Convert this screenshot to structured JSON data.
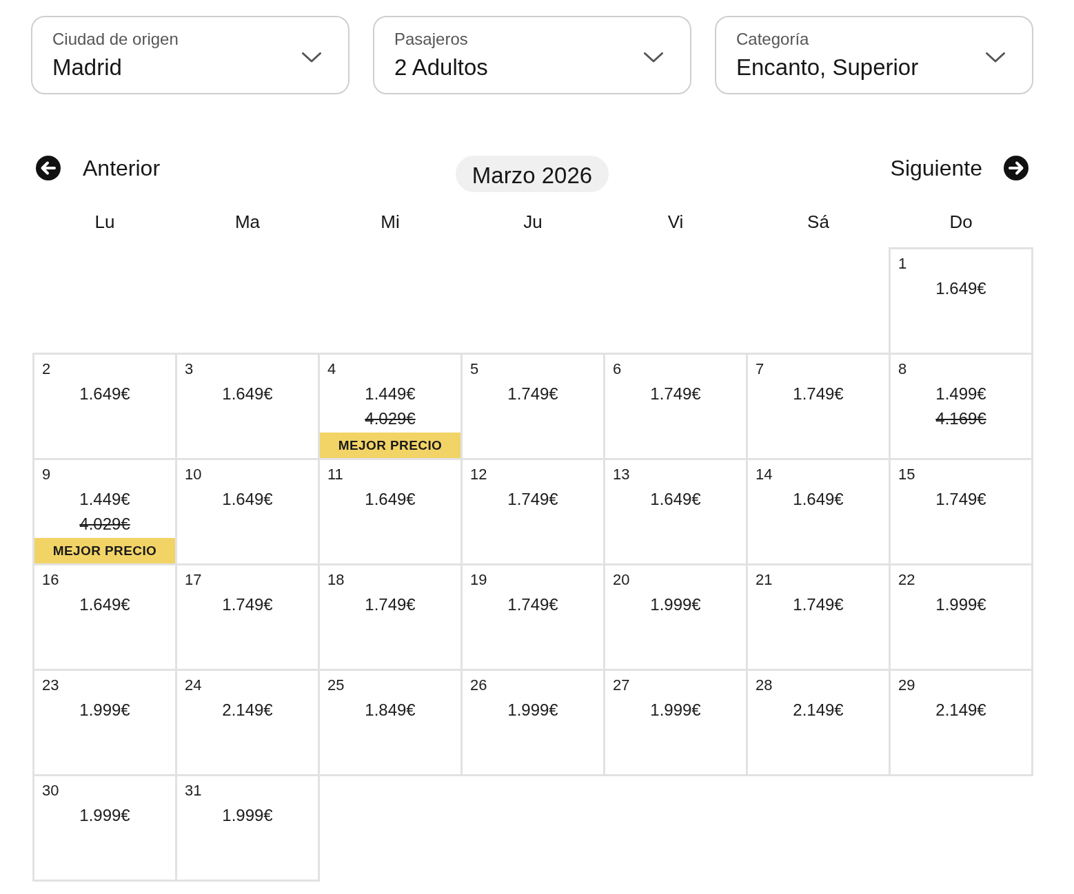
{
  "filters": [
    {
      "label": "Ciudad de origen",
      "value": "Madrid"
    },
    {
      "label": "Pasajeros",
      "value": "2 Adultos"
    },
    {
      "label": "Categoría",
      "value": "Encanto, Superior"
    }
  ],
  "navigation": {
    "previous": "Anterior",
    "month": "Marzo 2026",
    "next": "Siguiente"
  },
  "weekdays": [
    "Lu",
    "Ma",
    "Mi",
    "Ju",
    "Vi",
    "Sá",
    "Do"
  ],
  "weeks": [
    {
      "days": [
        {
          "kind": "blank"
        },
        {
          "kind": "blank"
        },
        {
          "kind": "blank"
        },
        {
          "kind": "blank"
        },
        {
          "kind": "blank"
        },
        {
          "kind": "blank"
        },
        {
          "kind": "day",
          "day": "1",
          "price": "1.649€"
        }
      ]
    },
    {
      "days": [
        {
          "kind": "day",
          "day": "2",
          "price": "1.649€"
        },
        {
          "kind": "day",
          "day": "3",
          "price": "1.649€"
        },
        {
          "kind": "day",
          "day": "4",
          "price": "1.449€",
          "original_price": "4.029€",
          "badge": "MEJOR PRECIO"
        },
        {
          "kind": "day",
          "day": "5",
          "price": "1.749€"
        },
        {
          "kind": "day",
          "day": "6",
          "price": "1.749€"
        },
        {
          "kind": "day",
          "day": "7",
          "price": "1.749€"
        },
        {
          "kind": "day",
          "day": "8",
          "price": "1.499€",
          "original_price": "4.169€"
        }
      ]
    },
    {
      "days": [
        {
          "kind": "day",
          "day": "9",
          "price": "1.449€",
          "original_price": "4.029€",
          "badge": "MEJOR PRECIO"
        },
        {
          "kind": "day",
          "day": "10",
          "price": "1.649€"
        },
        {
          "kind": "day",
          "day": "11",
          "price": "1.649€"
        },
        {
          "kind": "day",
          "day": "12",
          "price": "1.749€"
        },
        {
          "kind": "day",
          "day": "13",
          "price": "1.649€"
        },
        {
          "kind": "day",
          "day": "14",
          "price": "1.649€"
        },
        {
          "kind": "day",
          "day": "15",
          "price": "1.749€"
        }
      ]
    },
    {
      "days": [
        {
          "kind": "day",
          "day": "16",
          "price": "1.649€"
        },
        {
          "kind": "day",
          "day": "17",
          "price": "1.749€"
        },
        {
          "kind": "day",
          "day": "18",
          "price": "1.749€"
        },
        {
          "kind": "day",
          "day": "19",
          "price": "1.749€"
        },
        {
          "kind": "day",
          "day": "20",
          "price": "1.999€"
        },
        {
          "kind": "day",
          "day": "21",
          "price": "1.749€"
        },
        {
          "kind": "day",
          "day": "22",
          "price": "1.999€"
        }
      ]
    },
    {
      "days": [
        {
          "kind": "day",
          "day": "23",
          "price": "1.999€"
        },
        {
          "kind": "day",
          "day": "24",
          "price": "2.149€"
        },
        {
          "kind": "day",
          "day": "25",
          "price": "1.849€"
        },
        {
          "kind": "day",
          "day": "26",
          "price": "1.999€"
        },
        {
          "kind": "day",
          "day": "27",
          "price": "1.999€"
        },
        {
          "kind": "day",
          "day": "28",
          "price": "2.149€"
        },
        {
          "kind": "day",
          "day": "29",
          "price": "2.149€"
        }
      ]
    },
    {
      "days": [
        {
          "kind": "day",
          "day": "30",
          "price": "1.999€"
        },
        {
          "kind": "day",
          "day": "31",
          "price": "1.999€"
        }
      ]
    }
  ]
}
